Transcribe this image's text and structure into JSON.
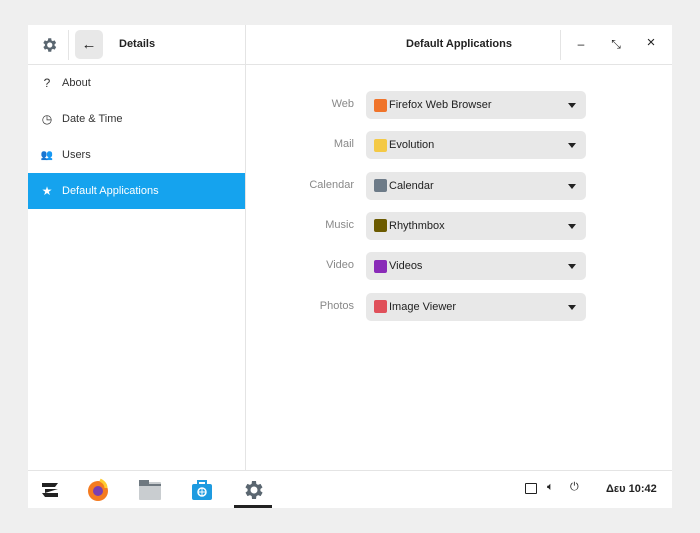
{
  "header": {
    "sidebar_title": "Details",
    "title": "Default Applications",
    "back_icon": "arrow-left-icon",
    "settings_icon": "gear-icon"
  },
  "window_controls": {
    "minimize": "–",
    "restore": "⤡",
    "close": "×"
  },
  "sidebar": {
    "items": [
      {
        "label": "About",
        "icon": "?"
      },
      {
        "label": "Date & Time",
        "icon": "◷"
      },
      {
        "label": "Users",
        "icon": "👥"
      },
      {
        "label": "Default Applications",
        "icon": "★",
        "active": true
      }
    ]
  },
  "defaults": [
    {
      "label": "Web",
      "app": "Firefox Web Browser",
      "color": "#f0742a"
    },
    {
      "label": "Mail",
      "app": "Evolution",
      "color": "#f4c945"
    },
    {
      "label": "Calendar",
      "app": "Calendar",
      "color": "#6d7b88"
    },
    {
      "label": "Music",
      "app": "Rhythmbox",
      "color": "#6b5a00"
    },
    {
      "label": "Video",
      "app": "Videos",
      "color": "#8a2bb8"
    },
    {
      "label": "Photos",
      "app": "Image Viewer",
      "color": "#e0505a"
    }
  ],
  "taskbar": {
    "clock": "Δευ 10:42",
    "accent": "#15a3ee"
  }
}
